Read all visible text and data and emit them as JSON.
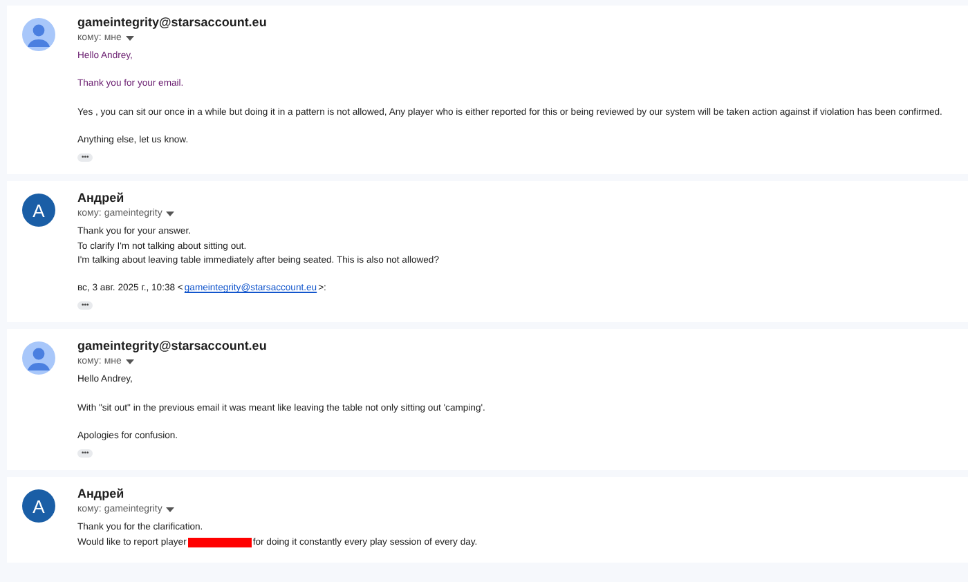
{
  "messages": [
    {
      "avatar": {
        "kind": "silhouette"
      },
      "sender": "gameintegrity@starsaccount.eu",
      "recipient": "кому: мне",
      "body": [
        {
          "kind": "text",
          "text": "Hello Andrey,",
          "color": "#681a6e"
        },
        {
          "kind": "blank"
        },
        {
          "kind": "text",
          "text": "Thank you for your email.",
          "color": "#681a6e"
        },
        {
          "kind": "blank"
        },
        {
          "kind": "text",
          "text": "Yes , you can sit our once in a while but doing it in a pattern is not allowed, Any player who is either reported for this or being reviewed by our system will be taken action against if violation has been confirmed.",
          "color": "#222222"
        },
        {
          "kind": "blank"
        },
        {
          "kind": "text",
          "text": "Anything else, let us know.",
          "color": "#222222"
        }
      ],
      "more": "•••"
    },
    {
      "avatar": {
        "kind": "letter",
        "letter": "A"
      },
      "sender": "Андрей",
      "recipient": "кому: gameintegrity",
      "body": [
        {
          "kind": "text",
          "text": "Thank you for your answer.",
          "color": "#222222"
        },
        {
          "kind": "text",
          "text": "To clarify I'm not talking about sitting out.",
          "color": "#222222"
        },
        {
          "kind": "text",
          "text": "I'm talking about leaving table immediately after being seated. This is also not allowed?",
          "color": "#222222"
        },
        {
          "kind": "blank"
        },
        {
          "kind": "quote",
          "before": "вс, 3 авг. 2025 г., 10:38 <",
          "link": "gameintegrity@starsaccount.eu",
          "after": ">:"
        }
      ],
      "more": "•••"
    },
    {
      "avatar": {
        "kind": "silhouette"
      },
      "sender": "gameintegrity@starsaccount.eu",
      "recipient": "кому: мне",
      "body": [
        {
          "kind": "text",
          "text": "Hello Andrey,",
          "color": "#222222"
        },
        {
          "kind": "blank"
        },
        {
          "kind": "text",
          "text": "With \"sit out\" in the previous email it was meant  like leaving the table not only sitting out 'camping'.",
          "color": "#222222"
        },
        {
          "kind": "blank"
        },
        {
          "kind": "text",
          "text": "Apologies for confusion.",
          "color": "#222222"
        }
      ],
      "more": "•••"
    },
    {
      "avatar": {
        "kind": "letter",
        "letter": "A"
      },
      "sender": "Андрей",
      "recipient": "кому: gameintegrity",
      "body": [
        {
          "kind": "text",
          "text": "Thank you for the clarification.",
          "color": "#222222"
        },
        {
          "kind": "redacted",
          "before": "Would like to report player",
          "after": "for doing it constantly every play session of every day."
        }
      ]
    }
  ]
}
